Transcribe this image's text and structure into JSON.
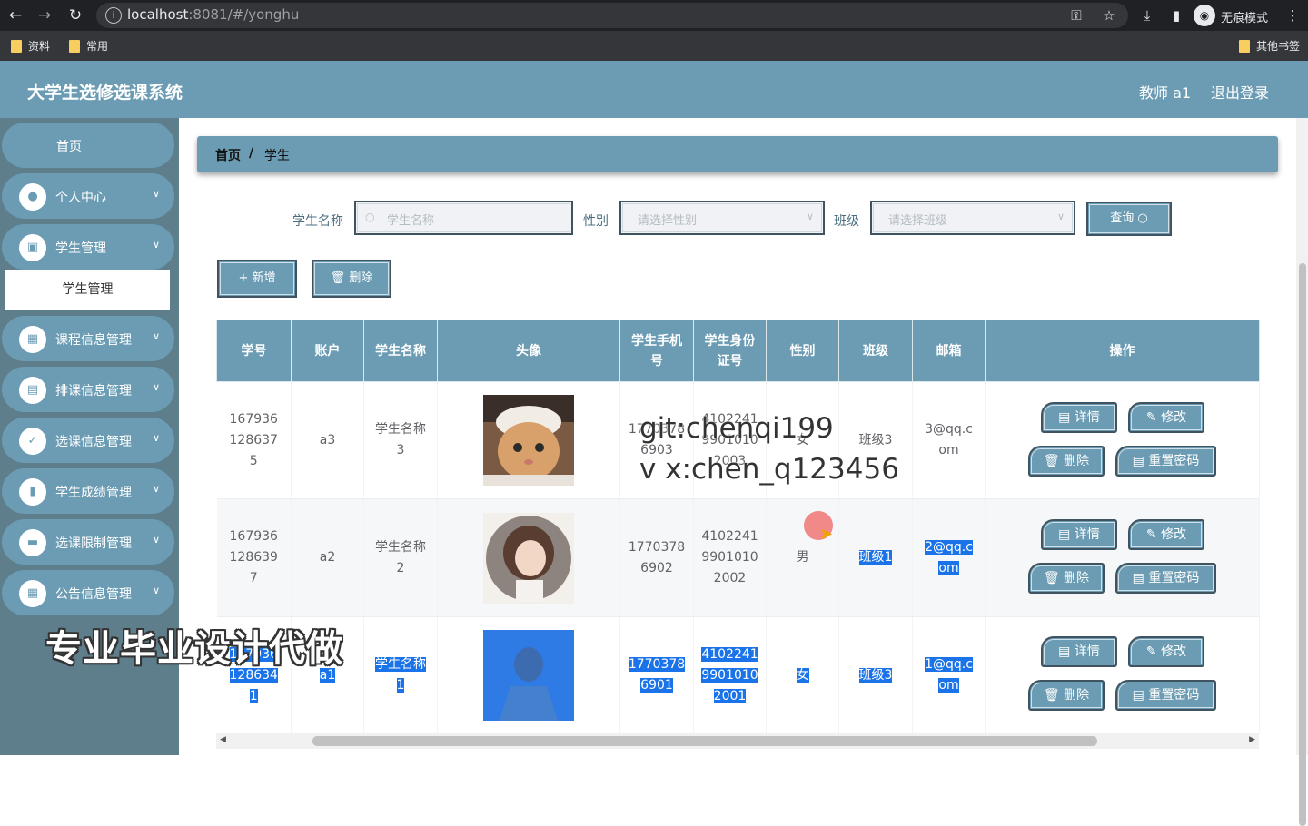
{
  "browser": {
    "url_host": "localhost",
    "url_rest": ":8081/#/yonghu",
    "incognito_label": "无痕模式",
    "bookmarks": [
      "资料",
      "常用"
    ],
    "other_bookmarks": "其他书签"
  },
  "header": {
    "title": "大学生选修选课系统",
    "user": "教师 a1",
    "logout": "退出登录"
  },
  "sidebar": {
    "home": "首页",
    "items": [
      {
        "label": "个人中心",
        "icon": "user-icon"
      },
      {
        "label": "学生管理",
        "icon": "briefcase-icon"
      },
      {
        "label": "课程信息管理",
        "icon": "grid-icon"
      },
      {
        "label": "排课信息管理",
        "icon": "clipboard-icon"
      },
      {
        "label": "选课信息管理",
        "icon": "clipboard-check-icon"
      },
      {
        "label": "学生成绩管理",
        "icon": "bar-chart-icon"
      },
      {
        "label": "选课限制管理",
        "icon": "monitor-icon"
      },
      {
        "label": "公告信息管理",
        "icon": "grid-icon"
      }
    ],
    "active_sub": "学生管理"
  },
  "breadcrumb": {
    "home": "首页",
    "separator": "/",
    "current": "学生"
  },
  "search": {
    "name_label": "学生名称",
    "name_placeholder": "学生名称",
    "gender_label": "性别",
    "gender_placeholder": "请选择性别",
    "class_label": "班级",
    "class_placeholder": "请选择班级",
    "query_button": "查询"
  },
  "actions": {
    "add": "新增",
    "delete": "删除"
  },
  "table": {
    "headers": [
      "学号",
      "账户",
      "学生名称",
      "头像",
      "学生手机号",
      "学生身份证号",
      "性别",
      "班级",
      "邮箱",
      "操作"
    ],
    "rows": [
      {
        "id": "1679361286375",
        "account": "a3",
        "name": "学生名称3",
        "phone": "17703786903",
        "idcard": "410224199010102003",
        "gender": "女",
        "class": "班级3",
        "email": "3@qq.com"
      },
      {
        "id": "1679361286397",
        "account": "a2",
        "name": "学生名称2",
        "phone": "17703786902",
        "idcard": "410224199010102002",
        "gender": "男",
        "class": "班级1",
        "email": "2@qq.com"
      },
      {
        "id": "1679361286341",
        "account": "a1",
        "name": "学生名称1",
        "phone": "17703786901",
        "idcard": "410224199010102001",
        "gender": "女",
        "class": "班级3",
        "email": "1@qq.com"
      }
    ],
    "ops": {
      "detail": "详情",
      "edit": "修改",
      "delete": "删除",
      "reset": "重置密码"
    }
  },
  "watermark": {
    "line1": "git:chenqi199",
    "line2": "v x:chen_q123456",
    "ad": "专业毕业设计代做"
  },
  "colors": {
    "primary": "#6b9cb3",
    "sidebar": "#5f7e8b",
    "selection": "#1a73e8"
  }
}
